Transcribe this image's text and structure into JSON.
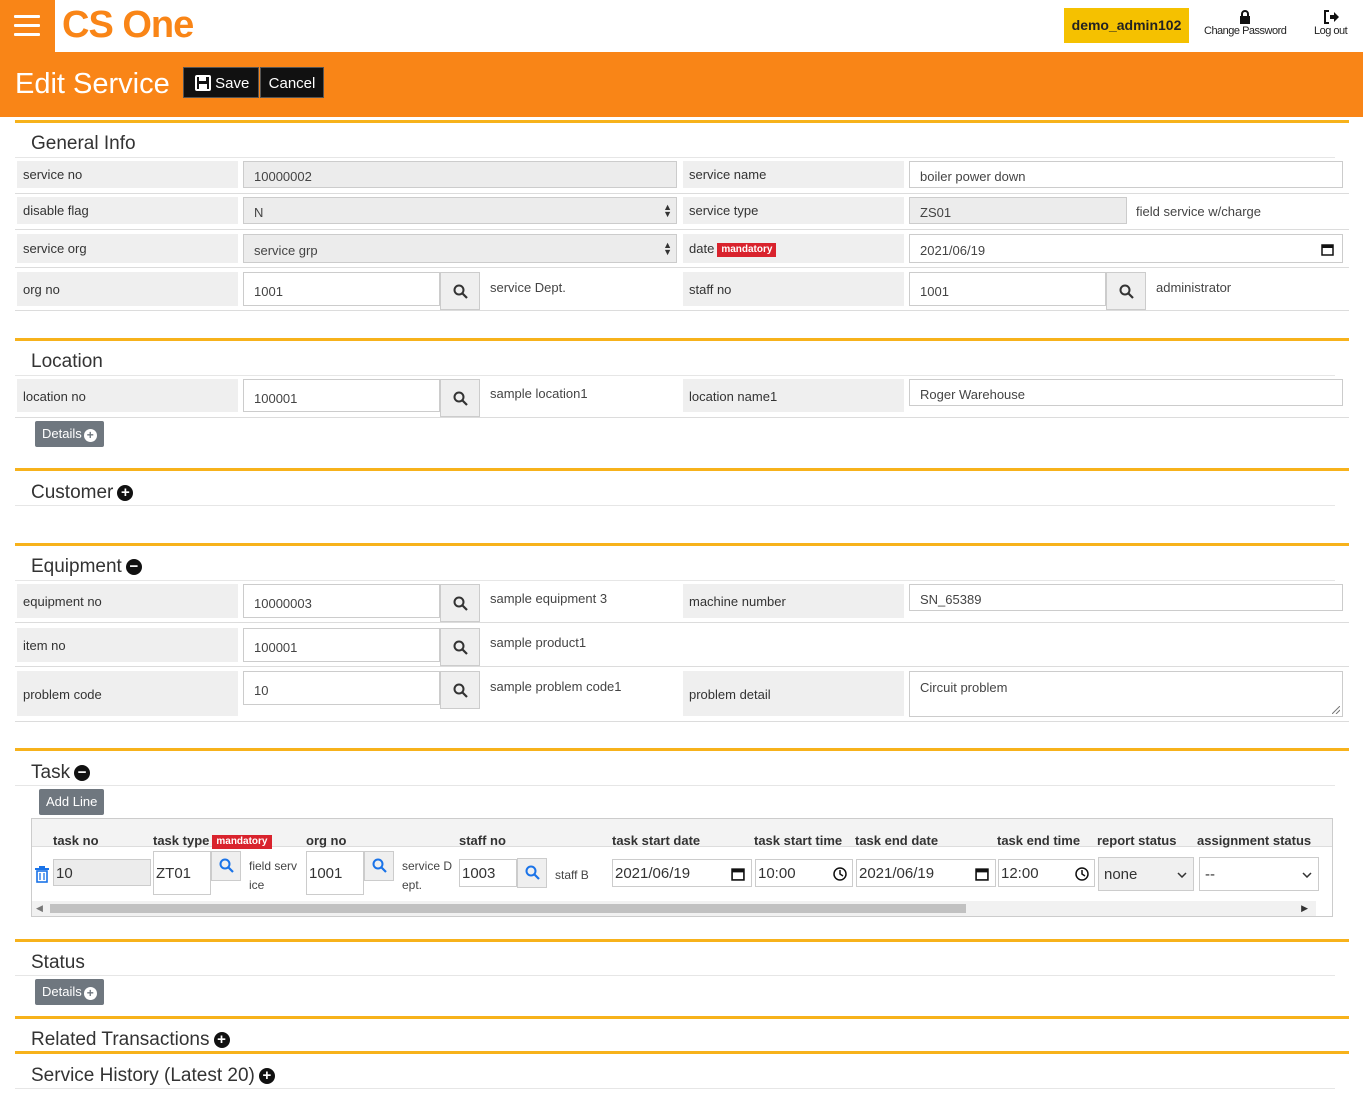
{
  "topbar": {
    "logo_cs": "CS",
    "logo_one": "One",
    "user": "demo_admin102",
    "change_password": "Change Password",
    "logout": "Log out"
  },
  "header": {
    "title": "Edit Service",
    "save_label": "Save",
    "cancel_label": "Cancel"
  },
  "mandatory_badge": "mandatory",
  "general": {
    "title": "General Info",
    "service_no_label": "service no",
    "service_no": "10000002",
    "service_name_label": "service name",
    "service_name": "boiler power down",
    "disable_flag_label": "disable flag",
    "disable_flag": "N",
    "service_type_label": "service type",
    "service_type": "ZS01",
    "service_type_desc": "field service w/charge",
    "service_org_label": "service org",
    "service_org": "service grp",
    "date_label": "date",
    "date": "2021/06/19",
    "org_no_label": "org no",
    "org_no": "1001",
    "org_desc": "service Dept.",
    "staff_no_label": "staff no",
    "staff_no": "1001",
    "staff_desc": "administrator"
  },
  "location": {
    "title": "Location",
    "location_no_label": "location no",
    "location_no": "100001",
    "location_desc": "sample location1",
    "location_name1_label": "location name1",
    "location_name1": "Roger Warehouse",
    "details_label": "Details"
  },
  "customer": {
    "title": "Customer"
  },
  "equipment": {
    "title": "Equipment",
    "equipment_no_label": "equipment no",
    "equipment_no": "10000003",
    "equipment_desc": "sample equipment 3",
    "machine_number_label": "machine number",
    "machine_number": "SN_65389",
    "item_no_label": "item no",
    "item_no": "100001",
    "item_desc": "sample product1",
    "problem_code_label": "problem code",
    "problem_code": "10",
    "problem_code_desc": "sample problem code1",
    "problem_detail_label": "problem detail",
    "problem_detail": "Circuit problem"
  },
  "task": {
    "title": "Task",
    "add_line_label": "Add Line",
    "columns": [
      "task no",
      "task type",
      "org no",
      "staff no",
      "task start date",
      "task start time",
      "task end date",
      "task end time",
      "report status",
      "assignment status"
    ],
    "row": {
      "task_no": "10",
      "task_type": "ZT01",
      "task_type_desc_1": "field serv",
      "task_type_desc_2": "ice",
      "org_no": "1001",
      "org_desc_1": "service D",
      "org_desc_2": "ept.",
      "staff_no": "1003",
      "staff_desc": "staff B",
      "start_date": "2021/06/19",
      "start_time": "10:00",
      "end_date": "2021/06/19",
      "end_time": "12:00",
      "report_status": "none",
      "assignment_status": "--"
    }
  },
  "status": {
    "title": "Status",
    "details_label": "Details"
  },
  "related": {
    "title": "Related Transactions"
  },
  "history": {
    "title": "Service History (Latest 20)"
  },
  "colors": {
    "brand_orange": "#f98517",
    "section_line": "#f7b21b",
    "user_badge": "#f5c100",
    "mandatory": "#d9232d"
  }
}
